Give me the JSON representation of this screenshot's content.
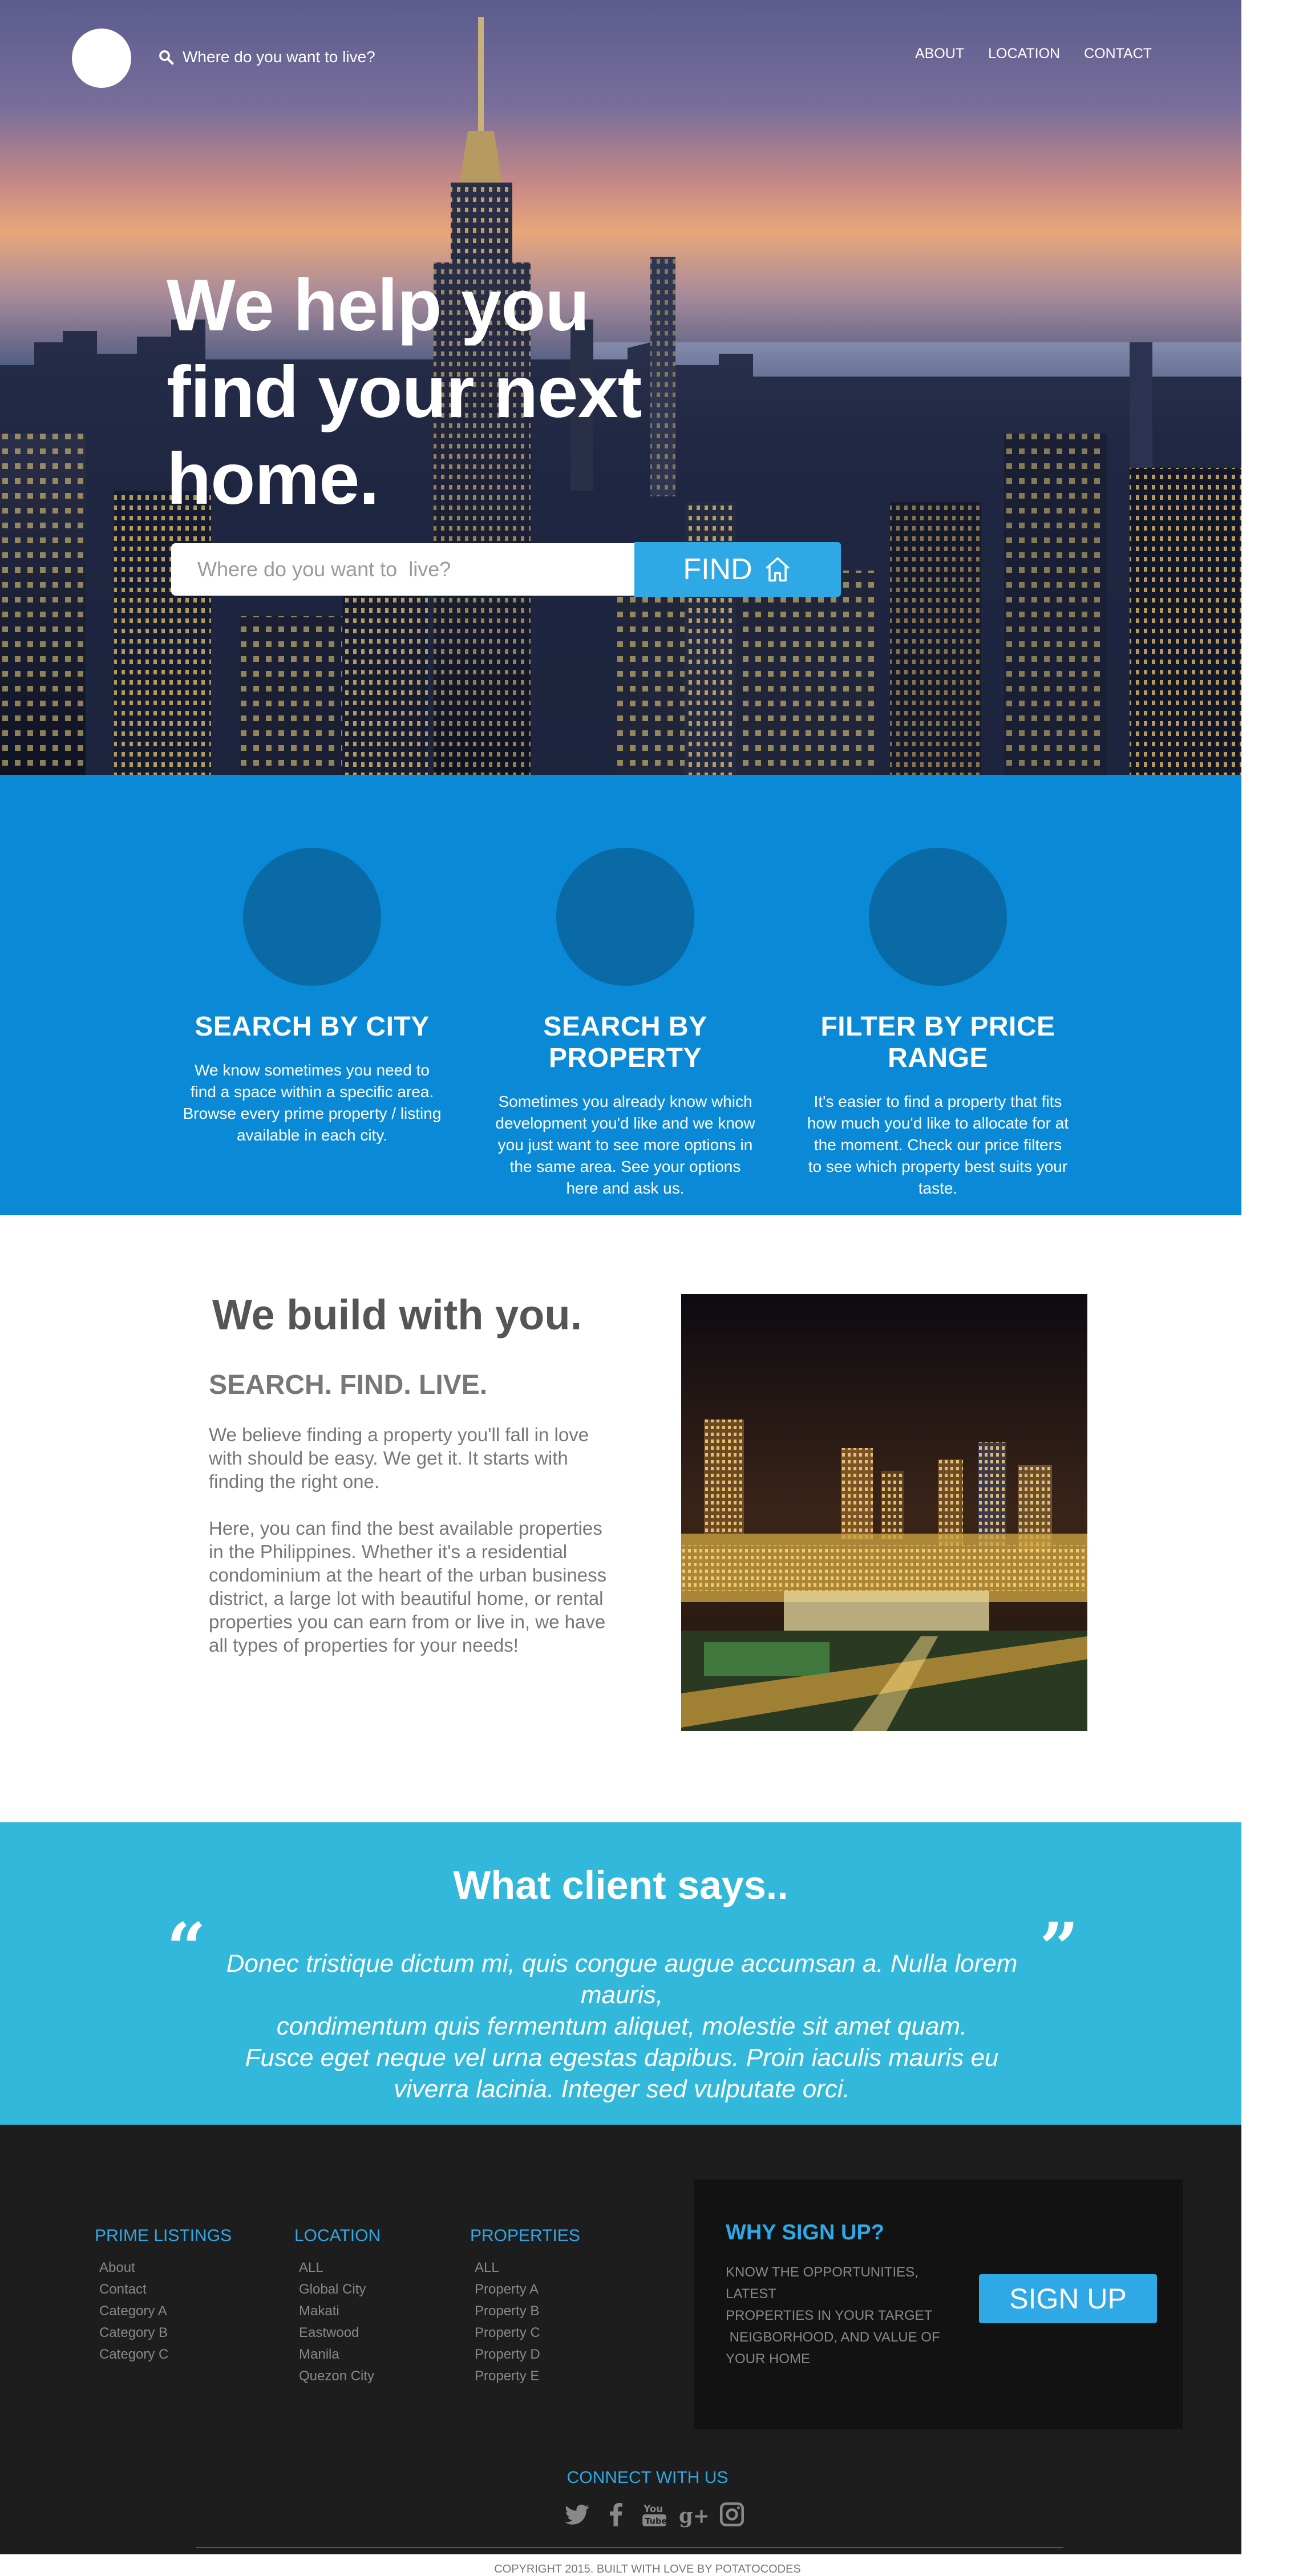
{
  "header": {
    "search_text": "Where do you want to live?",
    "nav": [
      "ABOUT",
      "LOCATION",
      "CONTACT"
    ]
  },
  "hero": {
    "headline_lines": [
      "We help you",
      "find your next",
      "home."
    ],
    "search_placeholder": "Where do you want to  live?",
    "find_label": "FIND"
  },
  "features": [
    {
      "title": "SEARCH BY CITY",
      "desc": "We know sometimes you need to find a space within a specific area. Browse every prime property / listing available in each city."
    },
    {
      "title": "SEARCH BY PROPERTY",
      "desc": "Sometimes you already know which development you'd like and we know you just want to see more options in the same area. See your options here and ask us."
    },
    {
      "title": "FILTER BY PRICE RANGE",
      "desc": "It's easier to find a property that fits how much you'd like to allocate for at the moment. Check our price filters to see which property best suits your taste."
    }
  ],
  "about": {
    "heading": "We build with you.",
    "subheading": "SEARCH. FIND. LIVE.",
    "paragraph1": "We believe finding a property you'll fall in love with should be easy. We get it. It starts with finding the right one.",
    "paragraph2": "Here, you can find the best available properties in the Philippines. Whether it's a residential condominium at the heart of the urban business district, a large lot with beautiful home, or rental properties you can earn from or live in, we have all types of properties for your needs!"
  },
  "testimonial": {
    "title": "What client says..",
    "open_quote": "“",
    "close_quote": "”",
    "quote_lines": [
      "Donec tristique dictum mi, quis congue augue accumsan a. Nulla lorem mauris,",
      "condimentum quis fermentum aliquet, molestie sit amet quam.",
      "Fusce eget neque vel urna egestas dapibus. Proin iaculis mauris eu",
      "viverra lacinia. Integer sed vulputate orci."
    ]
  },
  "footer": {
    "prime_listings": {
      "title": "PRIME LISTINGS",
      "items": [
        "About",
        "Contact",
        "Category A",
        "Category B",
        "Category C"
      ]
    },
    "location": {
      "title": "LOCATION",
      "items": [
        "ALL",
        "Global City",
        "Makati",
        "Eastwood",
        "Manila",
        "Quezon City"
      ]
    },
    "properties": {
      "title": "PROPERTIES",
      "items": [
        "ALL",
        "Property A",
        "Property B",
        "Property C",
        "Property D",
        "Property E"
      ]
    },
    "signup": {
      "title": "WHY SIGN UP?",
      "text_lines": [
        "KNOW THE OPPORTUNITIES,",
        "LATEST",
        "PROPERTIES IN YOUR TARGET",
        " NEIGBORHOOD, AND VALUE OF",
        "YOUR HOME"
      ],
      "button_label": "SIGN UP"
    },
    "connect_title": "CONNECT WITH US",
    "socials": [
      "twitter-icon",
      "facebook-icon",
      "youtube-icon",
      "google-plus-icon",
      "instagram-icon"
    ],
    "copyright": "COPYRIGHT 2015. BUILT WITH LOVE BY POTATOCODES"
  },
  "colors": {
    "primary_blue": "#0989d6",
    "accent_blue": "#2fa8e6",
    "testimonial_bg": "#32b8da",
    "footer_bg": "#1d1d1d"
  }
}
